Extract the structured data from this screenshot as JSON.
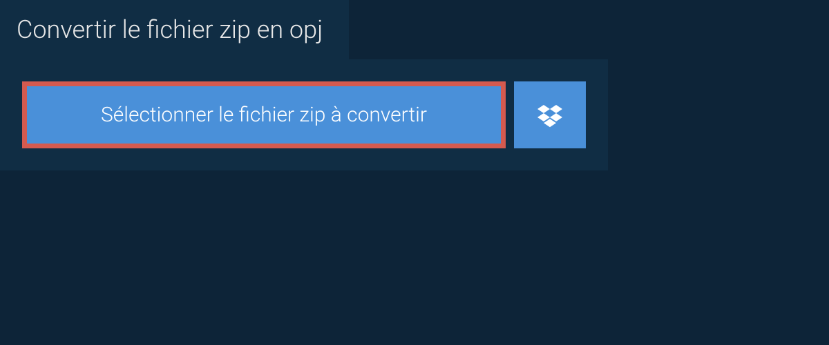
{
  "tab": {
    "title": "Convertir le fichier zip en opj"
  },
  "buttons": {
    "select_file_label": "Sélectionner le fichier zip à convertir"
  },
  "colors": {
    "background": "#0d2438",
    "panel": "#102d44",
    "button_primary": "#4a90d9",
    "button_highlight_border": "#d55a4f",
    "text_light": "#e8e8e8",
    "text_white": "#ffffff"
  }
}
